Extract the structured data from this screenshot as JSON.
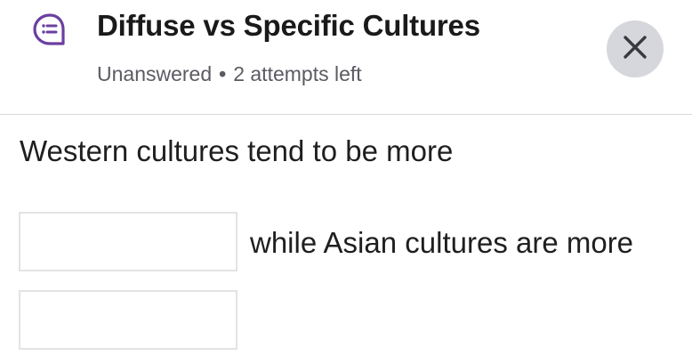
{
  "header": {
    "title": "Diffuse vs Specific Cultures",
    "status": "Unanswered",
    "separator": "•",
    "attempts": "2 attempts left",
    "icon": "question-bubble-icon",
    "close_icon": "close-icon"
  },
  "question": {
    "text_before": "Western cultures tend to be more",
    "text_between": "while Asian cultures are more",
    "blanks": [
      {
        "value": ""
      },
      {
        "value": ""
      }
    ]
  },
  "colors": {
    "accent": "#6b3fa0",
    "close_bg": "#d6d7dc",
    "divider": "#dadada",
    "meta_text": "#5b5b63"
  }
}
